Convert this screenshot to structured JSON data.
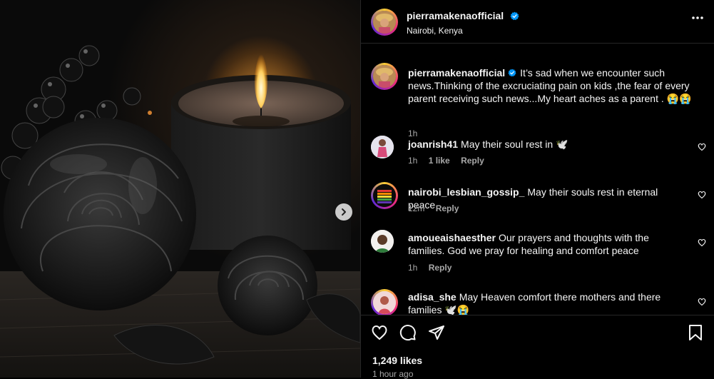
{
  "post": {
    "username": "pierramakenaofficial",
    "location": "Nairobi, Kenya",
    "caption": "It’s sad when we encounter such news.Thinking of the excruciating pain on kids ,the fear of every parent receiving such news...My heart aches as a parent . 😭😭",
    "caption_time": "1h",
    "likes": "1,249 likes",
    "posted_ago": "1 hour ago"
  },
  "comments": [
    {
      "username": "joanrish41",
      "text": "May their soul rest in 🕊️",
      "time": "1h",
      "likes": "1 like",
      "reply": "Reply"
    },
    {
      "username": "nairobi_lesbian_gossip_",
      "text": "May their souls rest in eternal peace",
      "time": "12m",
      "likes": "",
      "reply": "Reply"
    },
    {
      "username": "amoueaishaesther",
      "text": "Our prayers and thoughts with the families. God we pray for healing and comfort peace",
      "time": "1h",
      "likes": "",
      "reply": "Reply"
    },
    {
      "username": "adisa_she",
      "text": "May Heaven comfort there mothers and there families 🕊️😭",
      "time": "",
      "likes": "",
      "reply": ""
    }
  ],
  "icons": {
    "verified": "verified-badge-icon",
    "more": "more-options-icon",
    "next": "chevron-right-icon",
    "like": "heart-icon",
    "comment": "comment-icon",
    "share": "paper-plane-icon",
    "save": "bookmark-icon"
  },
  "colors": {
    "verified_blue": "#0095f6",
    "muted_text": "#a8a8a8",
    "background": "#000000"
  }
}
